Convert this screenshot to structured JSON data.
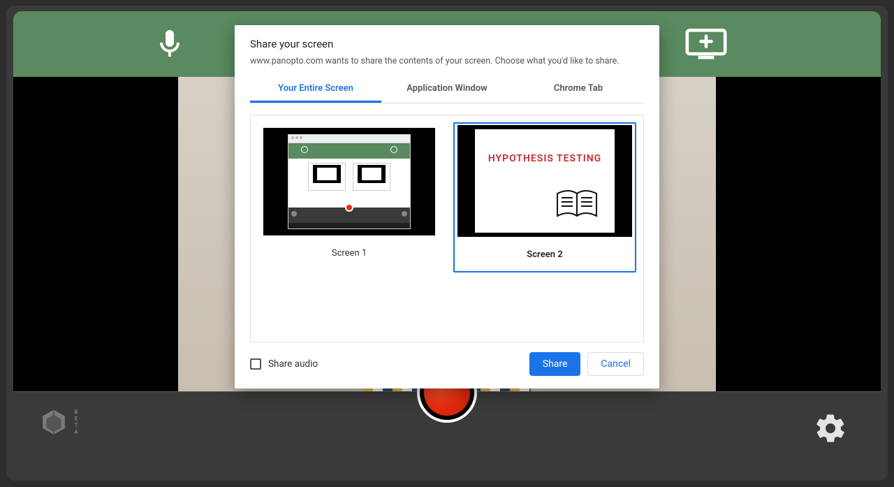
{
  "header": {
    "mic_name": "microphone-icon",
    "screen_name": "add-screen-icon"
  },
  "footer": {
    "beta_label": "BETA"
  },
  "modal": {
    "title": "Share your screen",
    "subtitle": "www.panopto.com wants to share the contents of your screen. Choose what you'd like to share.",
    "tabs": {
      "entire": "Your Entire Screen",
      "window": "Application Window",
      "chrome": "Chrome Tab"
    },
    "options": {
      "screen1_label": "Screen 1",
      "screen2_label": "Screen 2",
      "slide_text": "HYPOTHESIS TESTING"
    },
    "share_audio_label": "Share audio",
    "share_button": "Share",
    "cancel_button": "Cancel"
  }
}
